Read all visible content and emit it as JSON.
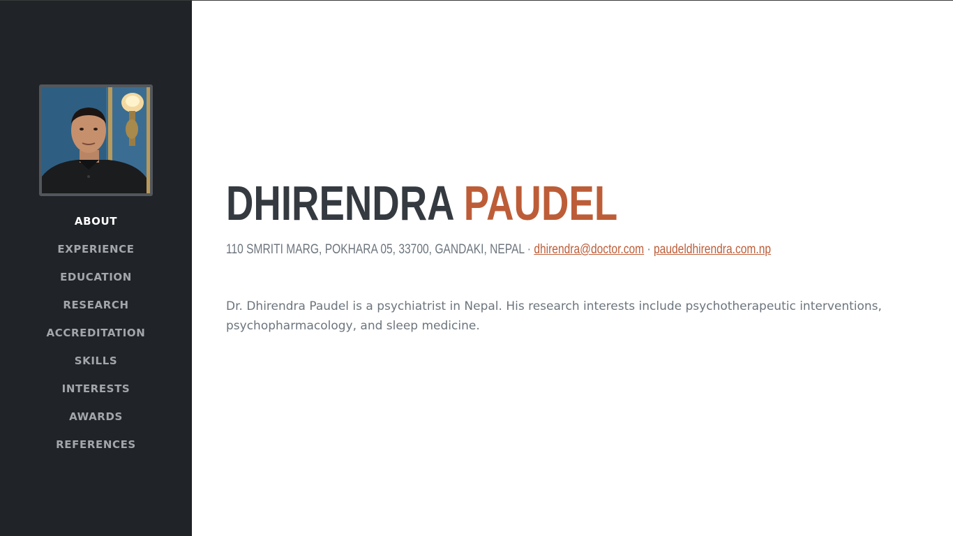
{
  "sidebar": {
    "avatar_alt": "",
    "nav": [
      {
        "label": "ABOUT",
        "active": true
      },
      {
        "label": "EXPERIENCE",
        "active": false
      },
      {
        "label": "EDUCATION",
        "active": false
      },
      {
        "label": "RESEARCH",
        "active": false
      },
      {
        "label": "ACCREDITATION",
        "active": false
      },
      {
        "label": "SKILLS",
        "active": false
      },
      {
        "label": "INTERESTS",
        "active": false
      },
      {
        "label": "AWARDS",
        "active": false
      },
      {
        "label": "REFERENCES",
        "active": false
      }
    ]
  },
  "about": {
    "first_name": "DHIRENDRA",
    "last_name": "PAUDEL",
    "address": "110 SMRITI MARG, POKHARA 05, 33700, GANDAKI, NEPAL",
    "separator": "·",
    "email": "dhirendra@doctor.com",
    "website": "paudeldhirendra.com.np",
    "bio": "Dr. Dhirendra Paudel is a psychiatrist in Nepal. His research interests include psychotherapeutic interventions, psychopharmacology, and sleep medicine."
  },
  "colors": {
    "sidebar_bg": "#202327",
    "accent": "#bd5d38",
    "heading": "#343a40",
    "text_muted": "#6c757d",
    "nav_inactive": "#a3a7ab",
    "nav_active": "#ffffff"
  }
}
